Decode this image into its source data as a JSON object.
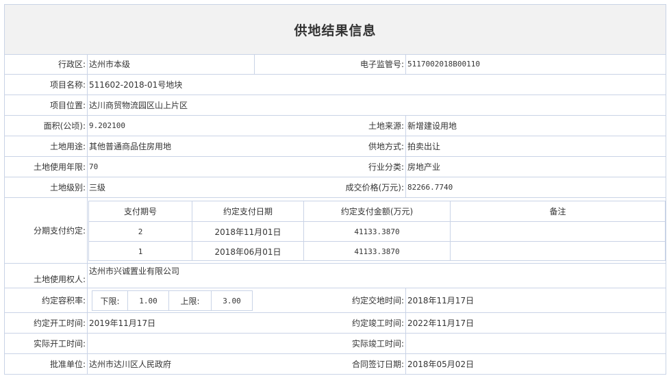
{
  "page_title": "供地结果信息",
  "fields": {
    "admin_area": {
      "label": "行政区:",
      "value": "达州市本级"
    },
    "e_supervision_no": {
      "label": "电子监管号:",
      "value": "5117002018B00110"
    },
    "project_name": {
      "label": "项目名称:",
      "value": "511602-2018-01号地块"
    },
    "project_location": {
      "label": "项目位置:",
      "value": "达川商贸物流园区山上片区"
    },
    "area": {
      "label": "面积(公顷):",
      "value": "9.202100"
    },
    "land_source": {
      "label": "土地来源:",
      "value": "新增建设用地"
    },
    "land_use": {
      "label": "土地用途:",
      "value": "其他普通商品住房用地"
    },
    "supply_method": {
      "label": "供地方式:",
      "value": "拍卖出让"
    },
    "use_years": {
      "label": "土地使用年限:",
      "value": "70"
    },
    "industry": {
      "label": "行业分类:",
      "value": "房地产业"
    },
    "land_grade": {
      "label": "土地级别:",
      "value": "三级"
    },
    "deal_price": {
      "label": "成交价格(万元):",
      "value": "82266.7740"
    },
    "installments_label": "分期支付约定:",
    "land_user": {
      "label": "土地使用权人:",
      "value": "达州市兴诚置业有限公司"
    },
    "far": {
      "label": "约定容积率:",
      "lower_label": "下限:",
      "lower_value": "1.00",
      "upper_label": "上限:",
      "upper_value": "3.00"
    },
    "handover_time": {
      "label": "约定交地时间:",
      "value": "2018年11月17日"
    },
    "start_time": {
      "label": "约定开工时间:",
      "value": "2019年11月17日"
    },
    "completion_time": {
      "label": "约定竣工时间:",
      "value": "2022年11月17日"
    },
    "actual_start": {
      "label": "实际开工时间:",
      "value": ""
    },
    "actual_completion": {
      "label": "实际竣工时间:",
      "value": ""
    },
    "approval_unit": {
      "label": "批准单位:",
      "value": "达州市达川区人民政府"
    },
    "contract_date": {
      "label": "合同签订日期:",
      "value": "2018年05月02日"
    }
  },
  "installments": {
    "headers": [
      "支付期号",
      "约定支付日期",
      "约定支付金额(万元)",
      "备注"
    ],
    "rows": [
      {
        "period": "2",
        "date": "2018年11月01日",
        "amount": "41133.3870",
        "note": ""
      },
      {
        "period": "1",
        "date": "2018年06月01日",
        "amount": "41133.3870",
        "note": ""
      }
    ]
  }
}
